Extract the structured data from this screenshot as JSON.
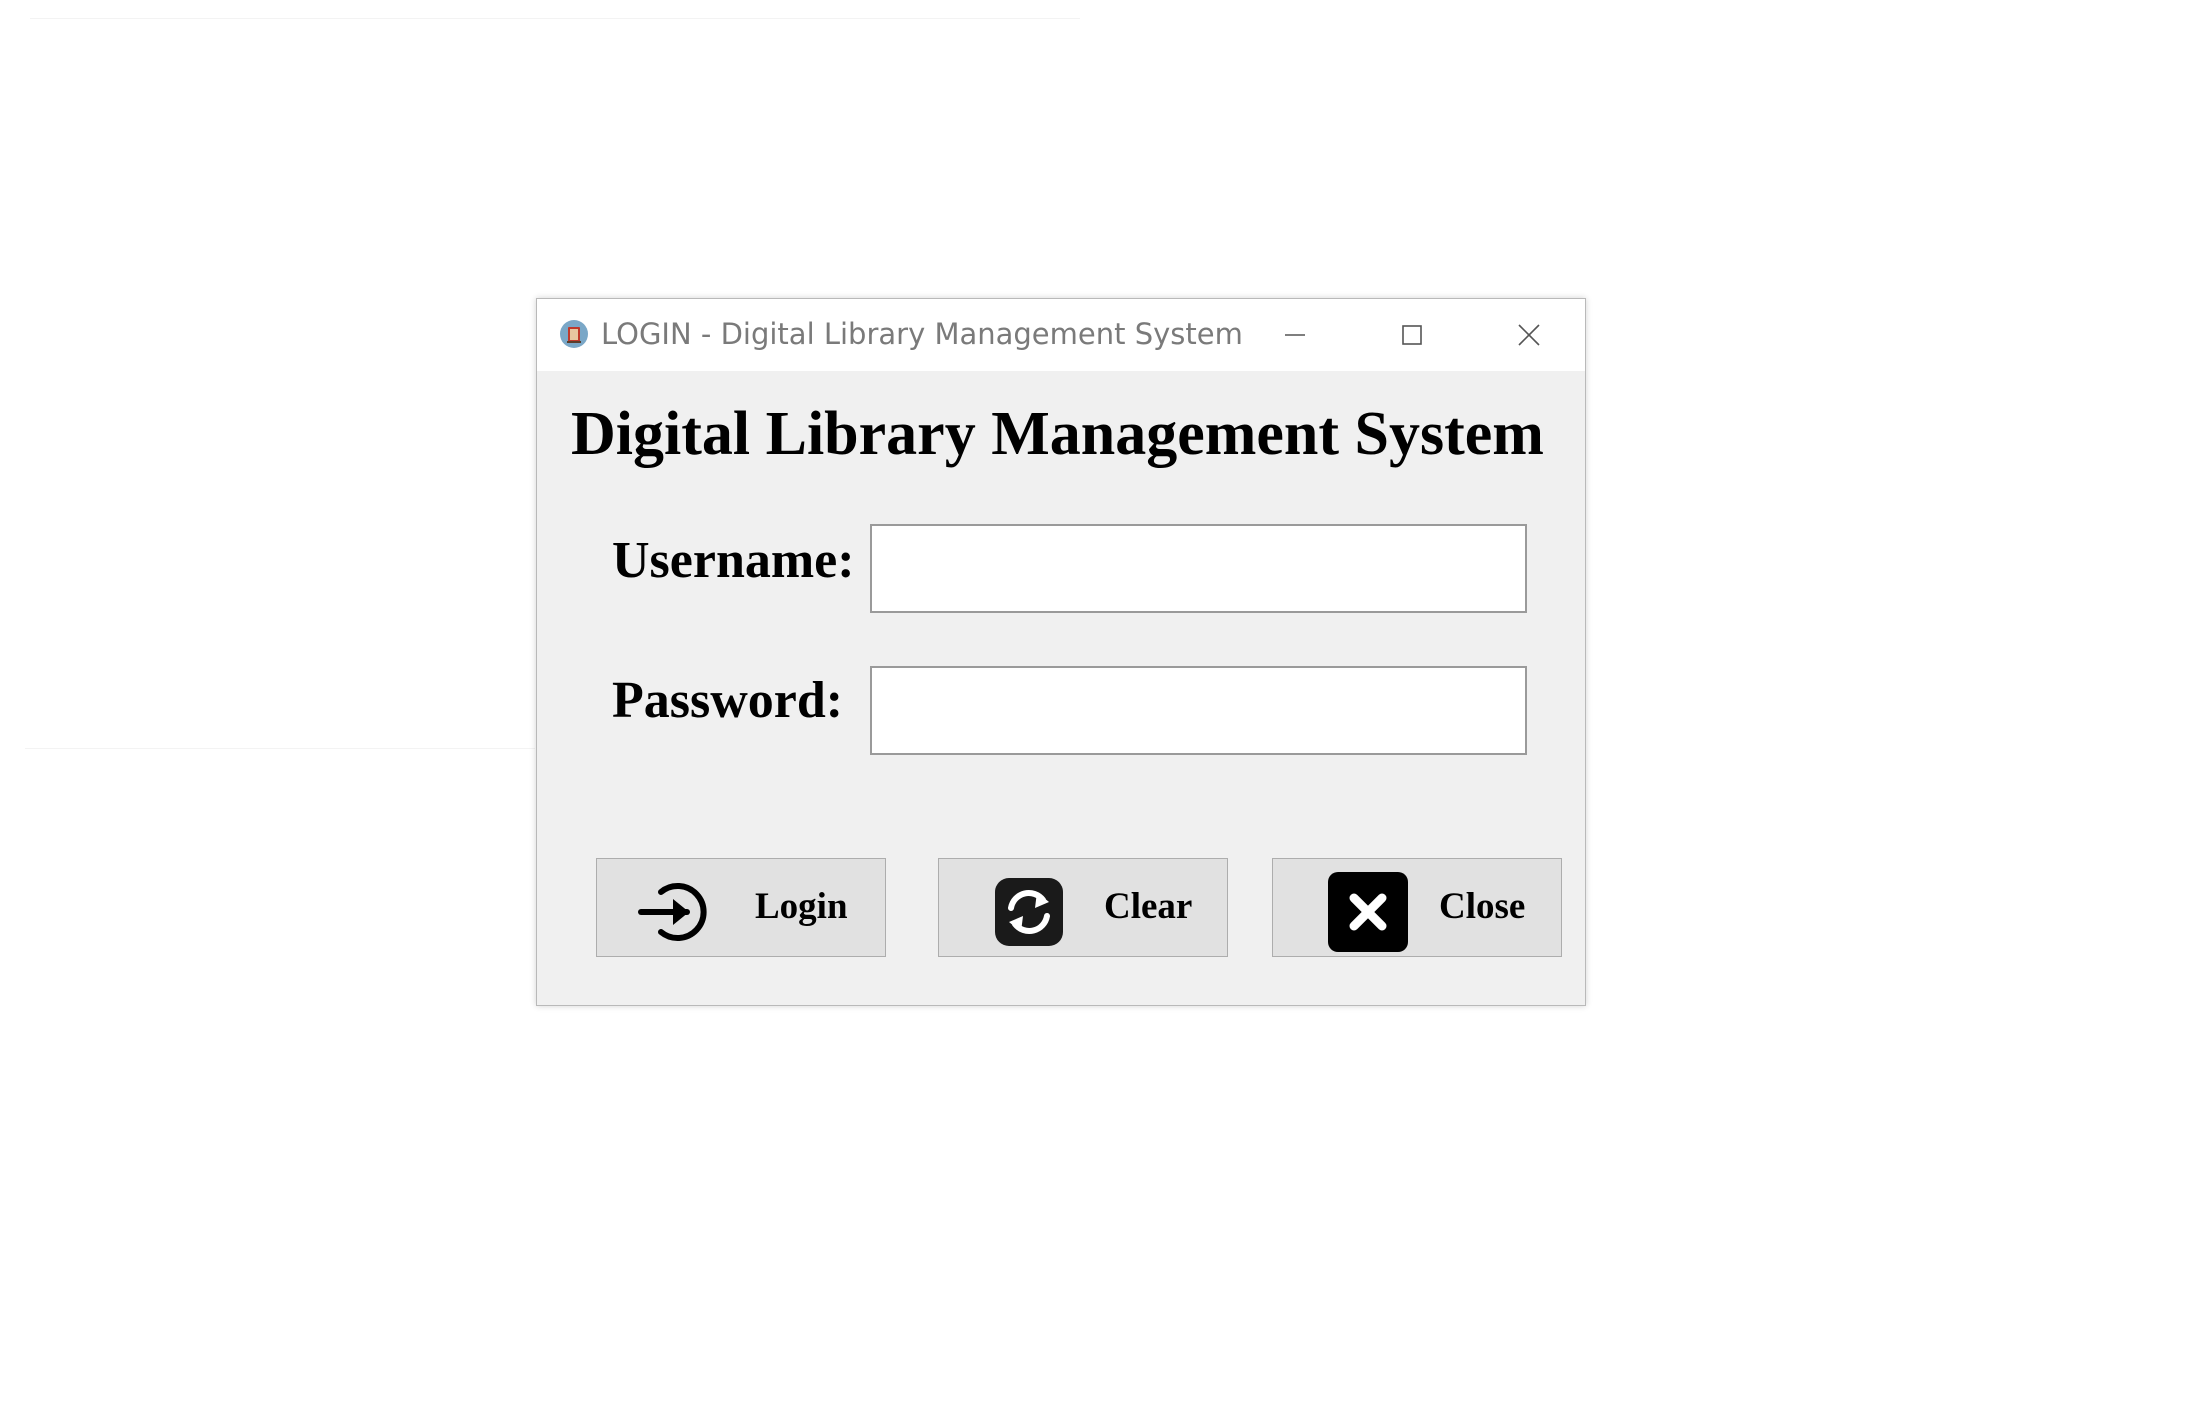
{
  "window": {
    "title": "LOGIN - Digital Library Management System",
    "controls": {
      "minimize": "minimize-icon",
      "maximize": "maximize-icon",
      "close": "close-icon"
    }
  },
  "form": {
    "heading": "Digital Library Management System",
    "username_label": "Username:",
    "username_value": "",
    "password_label": "Password:",
    "password_value": ""
  },
  "buttons": {
    "login": {
      "label": "Login",
      "icon": "login-arrow-icon"
    },
    "clear": {
      "label": "Clear",
      "icon": "refresh-icon"
    },
    "close": {
      "label": "Close",
      "icon": "close-x-icon"
    }
  },
  "colors": {
    "window_bg": "#f0f0f0",
    "titlebar_bg": "#ffffff",
    "button_bg": "#e1e1e1",
    "text": "#000000"
  }
}
